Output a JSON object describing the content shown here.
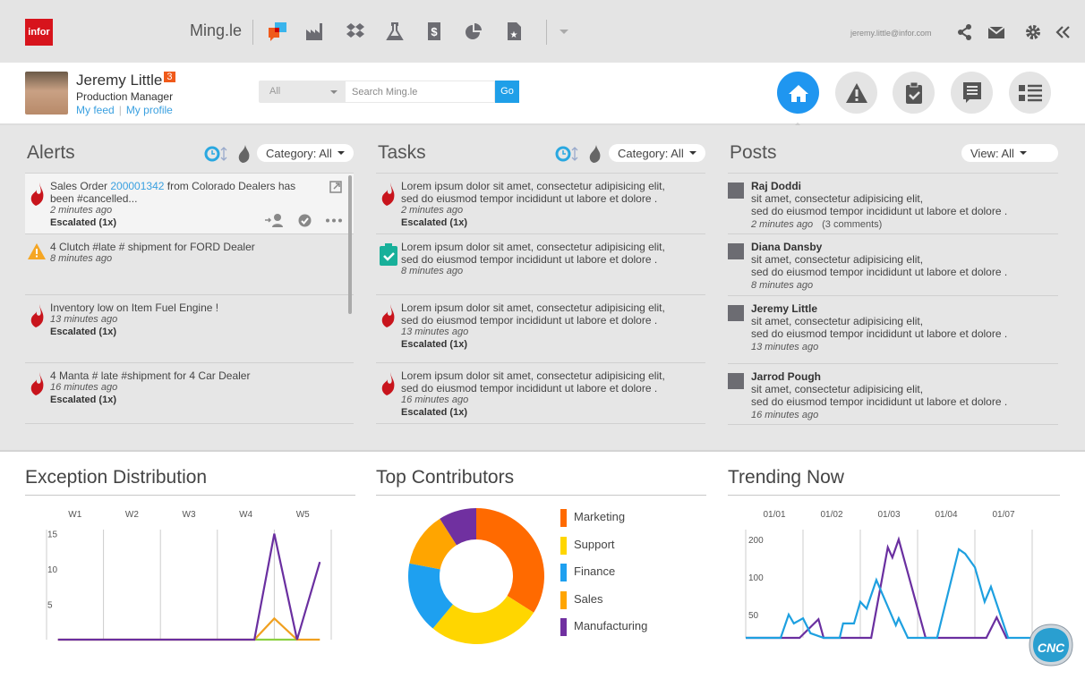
{
  "topbar": {
    "logo": "infor",
    "app_name": "Ming.le",
    "app_icons": [
      "mingle-chat-icon",
      "factory-icon",
      "dropbox-icon",
      "flask-icon",
      "dollar-document-icon",
      "pie-chart-icon",
      "starred-document-icon"
    ],
    "user_email": "jeremy.little@infor.com",
    "right_icons": [
      "share-icon",
      "mail-icon",
      "gear-icon",
      "collapse-icon"
    ]
  },
  "profile": {
    "name": "Jeremy Little",
    "badge_count": "3",
    "role": "Production Manager",
    "link_feed": "My feed",
    "link_separator": "|",
    "link_profile": "My profile"
  },
  "search": {
    "scope": "All",
    "placeholder": "Search Ming.le",
    "go_label": "Go"
  },
  "nav": {
    "items": [
      "home",
      "alerts",
      "tasks",
      "posts",
      "list"
    ],
    "active": "home",
    "accent": "#1f96f0"
  },
  "alerts": {
    "title": "Alerts",
    "filter": "Category: All",
    "items": [
      {
        "icon": "flame",
        "pre": "Sales Order ",
        "link": "200001342",
        "post": " from Colorado Dealers has been #cancelled...",
        "time": "2 minutes ago",
        "status": "Escalated (1x)",
        "selected": true
      },
      {
        "icon": "warning",
        "pre": "4 Clutch #late # shipment for FORD Dealer",
        "time": "8 minutes ago"
      },
      {
        "icon": "flame",
        "pre": "Inventory low on Item Fuel Engine !",
        "time": "13 minutes ago",
        "status": "Escalated (1x)"
      },
      {
        "icon": "flame",
        "pre": "4 Manta # late #shipment for 4 Car Dealer",
        "time": "16 minutes ago",
        "status": "Escalated (1x)"
      }
    ]
  },
  "tasks": {
    "title": "Tasks",
    "filter": "Category: All",
    "items": [
      {
        "icon": "flame",
        "pre": "Lorem ipsum dolor sit amet, consectetur adipisicing elit, sed do eiusmod tempor incididunt ut labore et dolore .",
        "time": "2 minutes ago",
        "status": "Escalated (1x)"
      },
      {
        "icon": "clipboard",
        "pre": "Lorem ipsum dolor sit amet, consectetur adipisicing elit, sed do eiusmod tempor incididunt ut labore et dolore .",
        "time": "8 minutes ago"
      },
      {
        "icon": "flame",
        "pre": "Lorem ipsum dolor sit amet, consectetur adipisicing elit, sed do eiusmod tempor incididunt ut labore et dolore .",
        "time": "13 minutes ago",
        "status": "Escalated (1x)"
      },
      {
        "icon": "flame",
        "pre": "Lorem ipsum dolor sit amet, consectetur adipisicing elit, sed do eiusmod tempor incididunt ut labore et dolore .",
        "time": "16 minutes ago",
        "status": "Escalated (1x)"
      }
    ]
  },
  "posts": {
    "title": "Posts",
    "filter": "View: All",
    "items": [
      {
        "name": "Raj Doddi",
        "line1": "sit amet, consectetur adipisicing elit,",
        "line2": "sed do eiusmod tempor incididunt ut labore et dolore .",
        "time": "2 minutes ago",
        "comments": "(3 comments)"
      },
      {
        "name": "Diana Dansby",
        "line1": "sit amet, consectetur adipisicing elit,",
        "line2": "sed do eiusmod tempor incididunt ut labore et dolore .",
        "time": "8 minutes ago"
      },
      {
        "name": "Jeremy Little",
        "line1": "sit amet, consectetur adipisicing elit,",
        "line2": "sed do eiusmod tempor incididunt ut labore et dolore .",
        "time": "13 minutes ago"
      },
      {
        "name": "Jarrod Pough",
        "line1": "sit amet, consectetur adipisicing elit,",
        "line2": "sed do eiusmod tempor incididunt ut labore et dolore .",
        "time": "16 minutes ago"
      }
    ]
  },
  "chart_data": [
    {
      "type": "line",
      "title": "Exception Distribution",
      "categories": [
        "W1",
        "W2",
        "W3",
        "W4",
        "W5"
      ],
      "y_ticks": [
        5,
        10,
        15
      ],
      "ylim": [
        0,
        16
      ],
      "grid": "vertical",
      "series": [
        {
          "color": "#6a2fa0",
          "x": [
            0.7,
            4.15,
            4.5,
            4.9,
            5.3
          ],
          "values": [
            0,
            0,
            15,
            0,
            11
          ]
        },
        {
          "color": "#f0a020",
          "x": [
            0.7,
            4.15,
            4.5,
            4.9,
            5.3
          ],
          "values": [
            0,
            0,
            3,
            0,
            0
          ]
        },
        {
          "color": "#8cd040",
          "x": [
            4.15,
            4.9
          ],
          "values": [
            0,
            0
          ]
        }
      ]
    },
    {
      "type": "pie",
      "title": "Top Contributors",
      "donut": true,
      "categories": [
        "Marketing",
        "Support",
        "Finance",
        "Sales",
        "Manufacturing"
      ],
      "values": [
        34,
        27,
        17,
        13,
        9
      ],
      "colors": [
        "#ff6a00",
        "#ffd600",
        "#1ea0f0",
        "#ffa500",
        "#7030a0"
      ],
      "legend": "right"
    },
    {
      "type": "line",
      "title": "Trending Now",
      "categories": [
        "01/01",
        "01/02",
        "01/03",
        "01/04",
        "01/07"
      ],
      "y_ticks": [
        50,
        100,
        200
      ],
      "y_scale": "non-linear",
      "grid": "vertical",
      "series": [
        {
          "color": "#1ea0e0",
          "x": [
            0,
            0.61,
            0.75,
            0.84,
            1.0,
            1.13,
            1.36,
            1.64,
            1.7,
            1.89,
            2.0,
            2.11,
            2.28,
            2.62,
            2.67,
            2.83,
            3.34,
            3.72,
            3.83,
            4.0,
            4.17,
            4.28,
            4.58,
            5.0
          ],
          "values": [
            0,
            0,
            50,
            31,
            42,
            10,
            0,
            0,
            31,
            31,
            67,
            58,
            96,
            27,
            42,
            0,
            0,
            174,
            162,
            126,
            67,
            87,
            0,
            0
          ]
        },
        {
          "color": "#6a2fa0",
          "x": [
            0,
            0.94,
            1.27,
            1.36,
            2.19,
            2.48,
            2.56,
            2.67,
            3.14,
            4.0,
            4.2,
            4.38,
            4.55,
            4.58
          ],
          "values": [
            0,
            0,
            40,
            0,
            0,
            179,
            152,
            200,
            0,
            0,
            0,
            44,
            0,
            0
          ]
        }
      ]
    }
  ]
}
